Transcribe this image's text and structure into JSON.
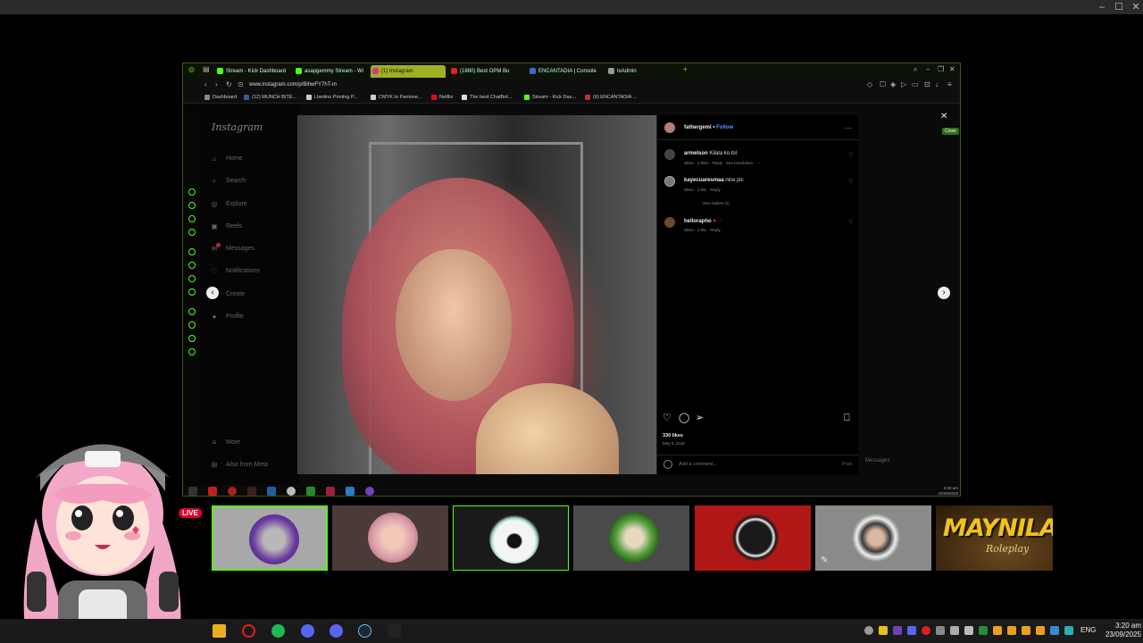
{
  "browser": {
    "tabs": [
      {
        "label": "Stream - Kick Dashboard"
      },
      {
        "label": "asapgemmy Stream - Wi"
      },
      {
        "label": "(1) Instagram"
      },
      {
        "label": "(1880) Best OPM Bu"
      },
      {
        "label": "ENCANTADIA | Console"
      },
      {
        "label": "txAdmin"
      }
    ],
    "url": "www.instagram.com/p/BihwFY7hT-m",
    "bookmarks": [
      {
        "label": "Dashboard"
      },
      {
        "label": "(12) MUNCH BITE..."
      },
      {
        "label": "Llantino Printing P..."
      },
      {
        "label": "CMYK to Pantone..."
      },
      {
        "label": "Netflix"
      },
      {
        "label": "The best ChatBot..."
      },
      {
        "label": "Stream - Kick Das..."
      },
      {
        "label": "(6) ENCANTADIA ..."
      }
    ]
  },
  "instagram": {
    "logo": "Instagram",
    "nav": [
      {
        "label": "Home",
        "icon": "home-icon",
        "glyph": "⌂"
      },
      {
        "label": "Search",
        "icon": "search-icon",
        "glyph": "⌕"
      },
      {
        "label": "Explore",
        "icon": "compass-icon",
        "glyph": "◎"
      },
      {
        "label": "Reels",
        "icon": "reels-icon",
        "glyph": "▣"
      },
      {
        "label": "Messages",
        "icon": "messages-icon",
        "glyph": "✉"
      },
      {
        "label": "Notifications",
        "icon": "heart-icon",
        "glyph": "♡"
      },
      {
        "label": "Create",
        "icon": "plus-icon",
        "glyph": "⊕"
      },
      {
        "label": "Profile",
        "icon": "profile-icon",
        "glyph": "●"
      }
    ],
    "more": "More",
    "also_from_meta": "Also from Meta",
    "close_tooltip": "Close",
    "messages_label": "Messages",
    "post": {
      "author": "fathergemi",
      "follow": "Follow",
      "comments": [
        {
          "user": "armelson",
          "text": "Kilala ko tol",
          "meta": "384w · 2 likes · Reply · See translation · ···"
        },
        {
          "user": "kayecuaresmaa",
          "text": "nice pic",
          "meta": "384w · 1 like · Reply",
          "view_replies": "View replies (1)"
        },
        {
          "user": "hellorapho",
          "text": "♥ ♡",
          "meta": "384w · 1 like · Reply"
        }
      ],
      "likes": "330 likes",
      "date": "May 9, 2018",
      "comment_placeholder": "Add a comment...",
      "post_button": "Post"
    }
  },
  "vm_clock": {
    "time": "3:20 am",
    "date": "23/09/2025"
  },
  "overlay": {
    "live_badge": "LIVE",
    "logo_line1": "MAYNILA",
    "logo_line2": "Roleplay"
  },
  "taskbar": {
    "lang": "ENG",
    "time": "3:20 am",
    "date": "23/09/2025"
  }
}
